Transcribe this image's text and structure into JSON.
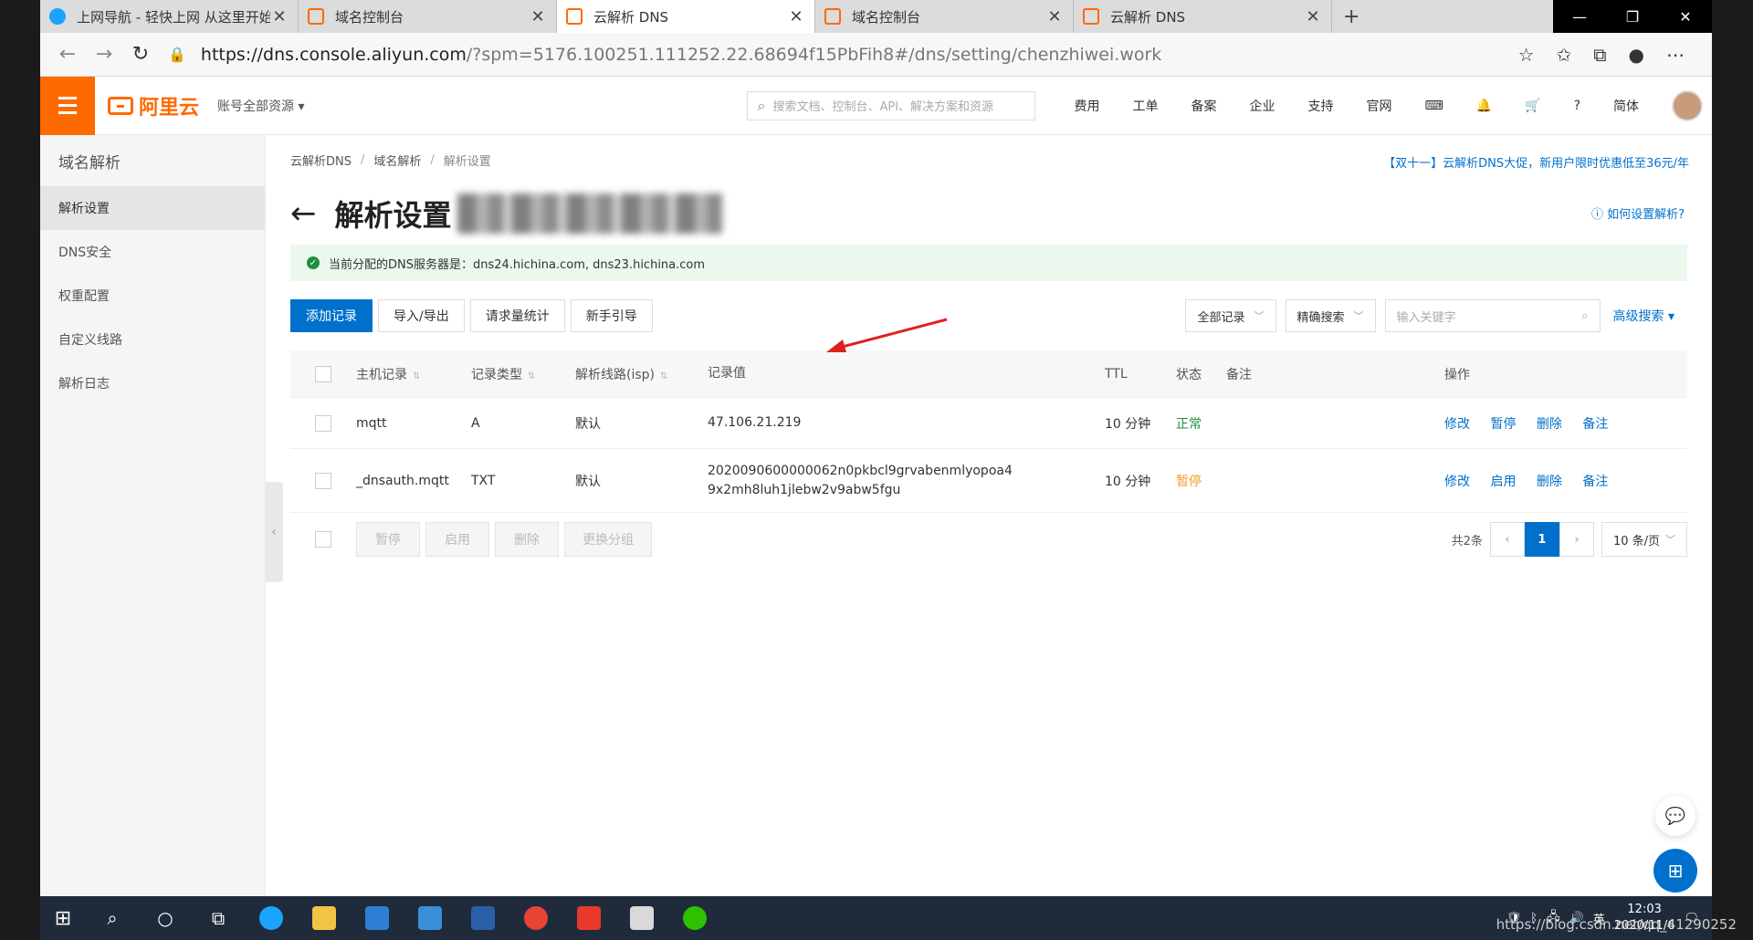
{
  "browser": {
    "tabs": [
      {
        "title": "上网导航 - 轻快上网 从这里开始",
        "color": "#1aa3ff"
      },
      {
        "title": "域名控制台",
        "color": "#ff6a00"
      },
      {
        "title": "云解析 DNS",
        "color": "#ff6a00"
      },
      {
        "title": "域名控制台",
        "color": "#ff6a00"
      },
      {
        "title": "云解析 DNS",
        "color": "#ff6a00"
      }
    ],
    "url_host": "https://dns.console.aliyun.com",
    "url_rest": "/?spm=5176.100251.111252.22.68694f15PbFih8#/dns/setting/chenzhiwei.work"
  },
  "header": {
    "logo": "阿里云",
    "account_scope": "账号全部资源",
    "search_placeholder": "搜索文档、控制台、API、解决方案和资源",
    "menu": [
      "费用",
      "工单",
      "备案",
      "企业",
      "支持",
      "官网"
    ],
    "lang": "简体"
  },
  "sidebar": {
    "title": "域名解析",
    "items": [
      "解析设置",
      "DNS安全",
      "权重配置",
      "自定义线路",
      "解析日志"
    ]
  },
  "breadcrumb": [
    "云解析DNS",
    "域名解析",
    "解析设置"
  ],
  "promo": "【双十一】云解析DNS大促，新用户限时优惠低至36元/年",
  "page_title": "解析设置",
  "howto": "如何设置解析?",
  "notice": "当前分配的DNS服务器是：dns24.hichina.com, dns23.hichina.com",
  "toolbar": {
    "add": "添加记录",
    "import": "导入/导出",
    "stats": "请求量统计",
    "guide": "新手引导",
    "filter": "全部记录",
    "exact": "精确搜索",
    "keyword_placeholder": "输入关键字",
    "advanced": "高级搜索"
  },
  "table": {
    "headers": [
      "主机记录",
      "记录类型",
      "解析线路(isp)",
      "记录值",
      "TTL",
      "状态",
      "备注",
      "操作"
    ],
    "rows": [
      {
        "host": "mqtt",
        "type": "A",
        "line": "默认",
        "value": "47.106.21.219",
        "ttl": "10 分钟",
        "status": "正常",
        "actions": [
          "修改",
          "暂停",
          "删除",
          "备注"
        ]
      },
      {
        "host": "_dnsauth.mqtt",
        "type": "TXT",
        "line": "默认",
        "value": "2020090600000062n0pkbcl9grvabenmlyopoa49x2mh8luh1jlebw2v9abw5fgu",
        "ttl": "10 分钟",
        "status": "暂停",
        "actions": [
          "修改",
          "启用",
          "删除",
          "备注"
        ]
      }
    ]
  },
  "footer": {
    "batch": [
      "暂停",
      "启用",
      "删除",
      "更换分组"
    ],
    "total": "共2条",
    "page": "1",
    "page_size": "10 条/页"
  },
  "taskbar": {
    "time": "12:03",
    "date": "2020/11/6",
    "ime": "英",
    "watermark": "https://blog.csdn.net/qq_41290252"
  }
}
